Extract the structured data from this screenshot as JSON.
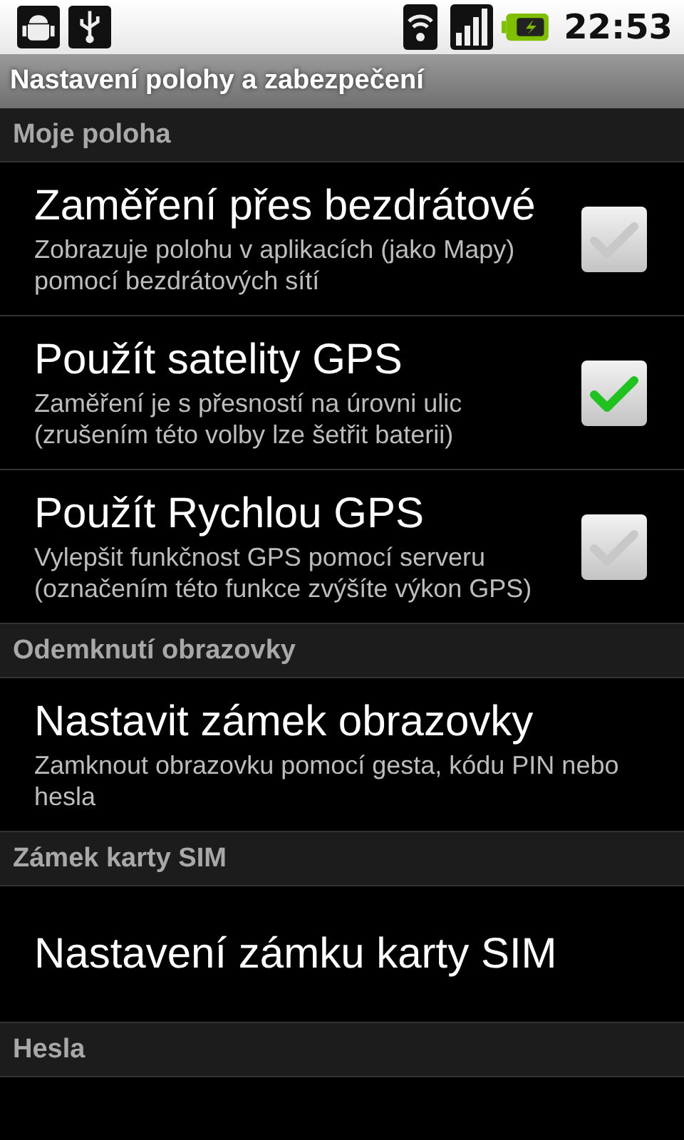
{
  "status_bar": {
    "time": "22:53"
  },
  "title_bar": {
    "title": "Nastavení polohy a zabezpečení"
  },
  "sections": [
    {
      "header": "Moje poloha",
      "items": [
        {
          "kind": "checkbox",
          "title": "Zaměření přes bezdrátové",
          "summary": "Zobrazuje polohu v aplikacích (jako Mapy) pomocí bezdrátových sítí",
          "checked": false
        },
        {
          "kind": "checkbox",
          "title": "Použít satelity GPS",
          "summary": "Zaměření je s přesností na úrovni ulic (zrušením této volby lze šetřit baterii)",
          "checked": true
        },
        {
          "kind": "checkbox",
          "title": "Použít Rychlou GPS",
          "summary": "Vylepšit funkčnost GPS pomocí serveru (označením této funkce zvýšíte výkon GPS)",
          "checked": false
        }
      ]
    },
    {
      "header": "Odemknutí obrazovky",
      "items": [
        {
          "kind": "link",
          "title": "Nastavit zámek obrazovky",
          "summary": "Zamknout obrazovku pomocí gesta, kódu PIN nebo hesla"
        }
      ]
    },
    {
      "header": "Zámek karty SIM",
      "items": [
        {
          "kind": "link",
          "title": "Nastavení zámku karty SIM"
        }
      ]
    },
    {
      "header": "Hesla"
    }
  ]
}
